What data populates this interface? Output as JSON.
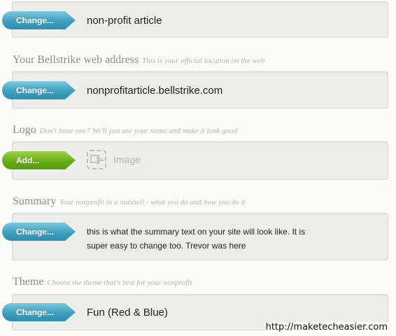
{
  "name_field": {
    "button": "Change...",
    "value": "non-profit article"
  },
  "web_address": {
    "title": "Your Bellstrike web address",
    "hint": "This is your official location on the web",
    "button": "Change...",
    "value": "nonprofitarticle.bellstrike.com"
  },
  "logo": {
    "title": "Logo",
    "hint": "Don't have one? We'll just use your name and make it look good",
    "button": "Add...",
    "placeholder_icon": "image-icon",
    "placeholder_label": "Image"
  },
  "summary": {
    "title": "Summary",
    "hint": "Your nonprofit in a nutshell - what you do and how you do it",
    "button": "Change...",
    "value": "this is what the summary text on your site will look like. It is super easy to change too. Trevor was here"
  },
  "theme": {
    "title": "Theme",
    "hint": "Choose the theme that's best for your nonprofit",
    "button": "Change...",
    "value": "Fun (Red & Blue)"
  },
  "watermark": "http://maketecheasier.com",
  "colors": {
    "blue_button": "#3f9fbf",
    "green_button": "#68ad17",
    "field_background": "#edeeec",
    "label_gray": "#8a8a8a"
  }
}
